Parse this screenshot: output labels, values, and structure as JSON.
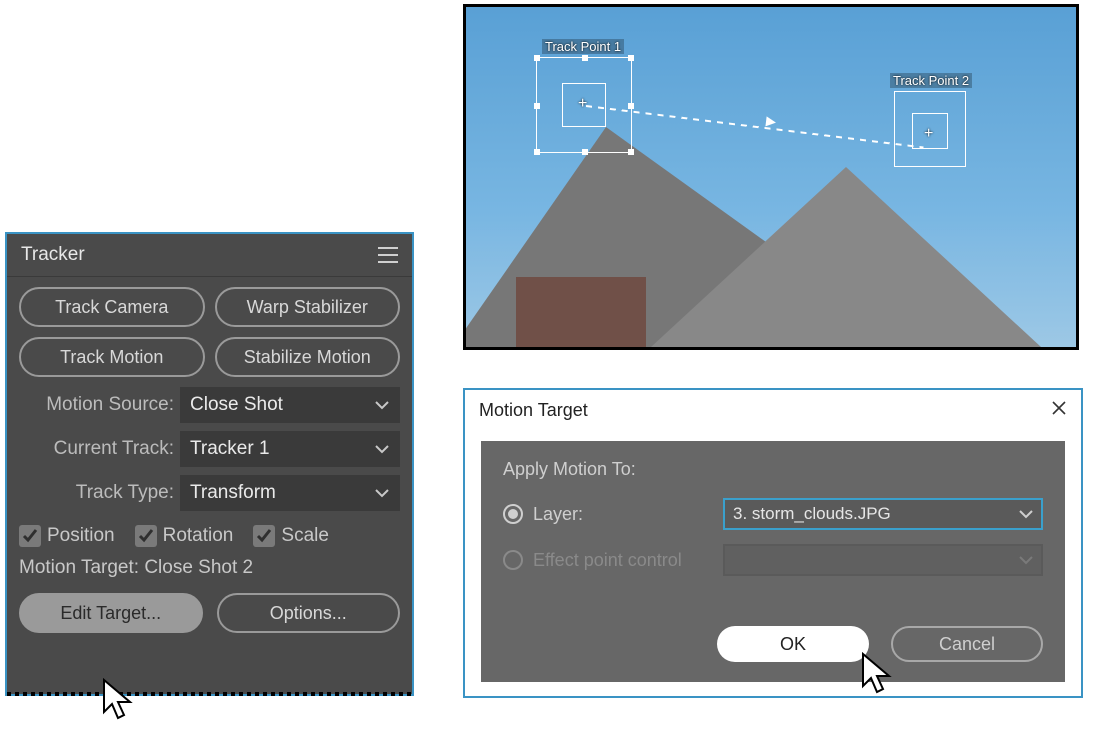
{
  "tracker": {
    "title": "Tracker",
    "buttons": {
      "track_camera": "Track Camera",
      "warp_stabilizer": "Warp Stabilizer",
      "track_motion": "Track Motion",
      "stabilize_motion": "Stabilize Motion"
    },
    "fields": {
      "motion_source_label": "Motion Source:",
      "motion_source_value": "Close Shot",
      "current_track_label": "Current Track:",
      "current_track_value": "Tracker 1",
      "track_type_label": "Track Type:",
      "track_type_value": "Transform"
    },
    "checks": {
      "position": "Position",
      "rotation": "Rotation",
      "scale": "Scale"
    },
    "motion_target_line": "Motion Target: Close Shot 2",
    "edit_target": "Edit Target...",
    "options": "Options..."
  },
  "preview": {
    "track_point_1": "Track Point 1",
    "track_point_2": "Track Point 2"
  },
  "dialog": {
    "title": "Motion Target",
    "apply_label": "Apply Motion To:",
    "layer_label": "Layer:",
    "layer_value": "3. storm_clouds.JPG",
    "effect_label": "Effect point control",
    "ok": "OK",
    "cancel": "Cancel"
  }
}
